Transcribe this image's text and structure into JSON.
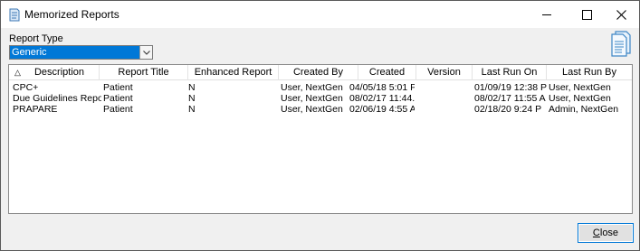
{
  "window": {
    "title": "Memorized Reports",
    "icon": "document-icon"
  },
  "report_type": {
    "label": "Report Type",
    "selected": "Generic",
    "options_visible": [
      "Generic"
    ]
  },
  "list": {
    "columns": [
      {
        "key": "description",
        "label": "Description",
        "sorted": "ascending"
      },
      {
        "key": "report_title",
        "label": "Report Title"
      },
      {
        "key": "enhanced_report",
        "label": "Enhanced Report"
      },
      {
        "key": "created_by",
        "label": "Created By"
      },
      {
        "key": "created",
        "label": "Created"
      },
      {
        "key": "version",
        "label": "Version"
      },
      {
        "key": "last_run_on",
        "label": "Last Run On"
      },
      {
        "key": "last_run_by",
        "label": "Last Run By"
      }
    ],
    "rows": [
      {
        "description": "CPC+",
        "report_title": "Patient",
        "enhanced_report": "N",
        "created_by": "User, NextGen",
        "created": "04/05/18 5:01 P",
        "version": "",
        "last_run_on": "01/09/19 12:38 P",
        "last_run_by": "User, NextGen"
      },
      {
        "description": "Due Guidelines Report",
        "report_title": "Patient",
        "enhanced_report": "N",
        "created_by": "User, NextGen",
        "created": "08/02/17 11:44...",
        "version": "",
        "last_run_on": "08/02/17 11:55 A",
        "last_run_by": "User, NextGen"
      },
      {
        "description": "PRAPARE",
        "report_title": "Patient",
        "enhanced_report": "N",
        "created_by": "User, NextGen",
        "created": "02/06/19 4:55 A",
        "version": "",
        "last_run_on": "02/18/20 9:24 P",
        "last_run_by": "Admin, NextGen"
      }
    ]
  },
  "buttons": {
    "close_accel": "C",
    "close_rest": "lose"
  },
  "colors": {
    "selection": "#0078d7",
    "window_bg": "#f0f0f0"
  }
}
